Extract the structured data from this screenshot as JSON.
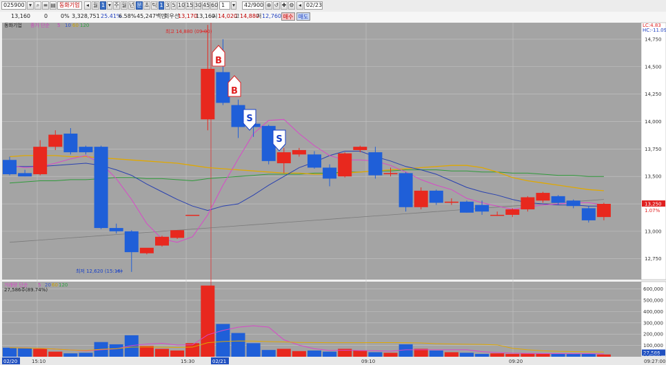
{
  "toolbar": {
    "code": "025900",
    "stock_name": "동화기업",
    "period_selected": "1",
    "tf": {
      "min_label": "분",
      "min_value": "1",
      "day": "주",
      "week": "월",
      "month": "년",
      "tick": "분",
      "sec": "초",
      "tic": "틱"
    },
    "intervals": [
      "1",
      "3",
      "5",
      "10",
      "15",
      "30",
      "45",
      "60"
    ],
    "count_value": "1",
    "count_display": "42/900",
    "date_value": "02/23"
  },
  "info": {
    "volume": "13,160",
    "change_value": "0",
    "change_pct": "0%",
    "trade_volume": "3,328,751",
    "vol_ratio1": "25.41%",
    "vol_ratio2": "6.58%",
    "amount": "45,247백만",
    "prev_close_label": "회우선",
    "prev_close": "13,170",
    "current": "13,160",
    "open_label": "시",
    "open": "14,020",
    "high_label": "고",
    "high": "14,880",
    "low_label": "저",
    "low": "12,760",
    "buy_button": "매수",
    "sell_button": "매도"
  },
  "chart_data": {
    "type": "candlestick",
    "title": "동화기업",
    "legend": {
      "label": "종가 단순",
      "periods": [
        "5",
        "10",
        "60",
        "120"
      ],
      "colors": [
        "#d040c0",
        "#3050c8",
        "#c8a000",
        "#30a040"
      ]
    },
    "side_labels": {
      "lc": "LC:4.83",
      "hc": "HC:-11.09"
    },
    "price_axis": {
      "min": 12560,
      "max": 14900,
      "ticks": [
        12750,
        13000,
        13250,
        13500,
        13750,
        14000,
        14250,
        14500,
        14750
      ]
    },
    "current_price_label": "13,250",
    "current_pct_label": "1.07%",
    "high_annotation": "최고 14,880 (09:00)",
    "low_annotation": "최저 12,620 (15:16)",
    "date_separators": [
      "02/20",
      "02/21"
    ],
    "time_labels": [
      "15:10",
      "15:30",
      "09:10",
      "09:20"
    ],
    "x_end_label": "09:27:00",
    "candles": [
      {
        "o": 13650,
        "h": 13680,
        "l": 13510,
        "c": 13520
      },
      {
        "o": 13530,
        "h": 13560,
        "l": 13500,
        "c": 13500
      },
      {
        "o": 13520,
        "h": 13830,
        "l": 13510,
        "c": 13770
      },
      {
        "o": 13770,
        "h": 13920,
        "l": 13740,
        "c": 13880
      },
      {
        "o": 13890,
        "h": 13940,
        "l": 13700,
        "c": 13720
      },
      {
        "o": 13770,
        "h": 13780,
        "l": 13700,
        "c": 13720
      },
      {
        "o": 13770,
        "h": 13780,
        "l": 13020,
        "c": 13030
      },
      {
        "o": 13030,
        "h": 13070,
        "l": 12980,
        "c": 13000
      },
      {
        "o": 13000,
        "h": 13010,
        "l": 12630,
        "c": 12810
      },
      {
        "o": 12800,
        "h": 12830,
        "l": 12790,
        "c": 12850
      },
      {
        "o": 12870,
        "h": 12960,
        "l": 12860,
        "c": 12950
      },
      {
        "o": 12940,
        "h": 13010,
        "l": 12930,
        "c": 13010
      },
      {
        "o": 13150,
        "h": 13150,
        "l": 13150,
        "c": 13150
      },
      {
        "o": 14020,
        "h": 14880,
        "l": 13920,
        "c": 14480
      },
      {
        "o": 14450,
        "h": 14750,
        "l": 14150,
        "c": 14170
      },
      {
        "o": 14150,
        "h": 14200,
        "l": 13850,
        "c": 13950
      },
      {
        "o": 13980,
        "h": 14000,
        "l": 13860,
        "c": 13950
      },
      {
        "o": 13960,
        "h": 13970,
        "l": 13610,
        "c": 13640
      },
      {
        "o": 13620,
        "h": 13760,
        "l": 13530,
        "c": 13720
      },
      {
        "o": 13700,
        "h": 13760,
        "l": 13680,
        "c": 13740
      },
      {
        "o": 13700,
        "h": 13730,
        "l": 13570,
        "c": 13580
      },
      {
        "o": 13580,
        "h": 13610,
        "l": 13410,
        "c": 13480
      },
      {
        "o": 13500,
        "h": 13720,
        "l": 13490,
        "c": 13710
      },
      {
        "o": 13740,
        "h": 13780,
        "l": 13720,
        "c": 13770
      },
      {
        "o": 13720,
        "h": 13770,
        "l": 13480,
        "c": 13510
      },
      {
        "o": 13520,
        "h": 13580,
        "l": 13500,
        "c": 13530
      },
      {
        "o": 13530,
        "h": 13540,
        "l": 13180,
        "c": 13220
      },
      {
        "o": 13220,
        "h": 13400,
        "l": 13200,
        "c": 13370
      },
      {
        "o": 13370,
        "h": 13380,
        "l": 13240,
        "c": 13260
      },
      {
        "o": 13260,
        "h": 13300,
        "l": 13240,
        "c": 13270
      },
      {
        "o": 13270,
        "h": 13280,
        "l": 13170,
        "c": 13170
      },
      {
        "o": 13240,
        "h": 13280,
        "l": 13150,
        "c": 13180
      },
      {
        "o": 13150,
        "h": 13180,
        "l": 13140,
        "c": 13150
      },
      {
        "o": 13150,
        "h": 13210,
        "l": 13130,
        "c": 13200
      },
      {
        "o": 13200,
        "h": 13320,
        "l": 13180,
        "c": 13310
      },
      {
        "o": 13280,
        "h": 13360,
        "l": 13260,
        "c": 13350
      },
      {
        "o": 13320,
        "h": 13330,
        "l": 13240,
        "c": 13260
      },
      {
        "o": 13280,
        "h": 13290,
        "l": 13210,
        "c": 13230
      },
      {
        "o": 13210,
        "h": 13230,
        "l": 13080,
        "c": 13100
      },
      {
        "o": 13130,
        "h": 13260,
        "l": 13100,
        "c": 13250
      }
    ],
    "buy_signals": [
      13,
      14
    ],
    "sell_signals": [
      15,
      17
    ],
    "ma5": [
      13600,
      13580,
      13590,
      13620,
      13660,
      13690,
      13620,
      13480,
      13290,
      13070,
      12930,
      12900,
      12950,
      13150,
      13420,
      13660,
      13890,
      14010,
      14020,
      13890,
      13780,
      13690,
      13650,
      13650,
      13640,
      13600,
      13540,
      13470,
      13420,
      13380,
      13300,
      13260,
      13230,
      13200,
      13220,
      13240,
      13250,
      13260,
      13260,
      13240
    ],
    "ma10": [
      13590,
      13590,
      13590,
      13600,
      13610,
      13620,
      13600,
      13560,
      13510,
      13430,
      13360,
      13290,
      13230,
      13190,
      13230,
      13250,
      13330,
      13420,
      13500,
      13580,
      13630,
      13690,
      13730,
      13730,
      13680,
      13640,
      13590,
      13560,
      13520,
      13460,
      13400,
      13360,
      13330,
      13290,
      13260,
      13250,
      13240,
      13240,
      13230,
      13230
    ],
    "ma60": [
      13680,
      13690,
      13690,
      13690,
      13680,
      13680,
      13670,
      13660,
      13650,
      13640,
      13630,
      13620,
      13600,
      13580,
      13570,
      13560,
      13550,
      13540,
      13530,
      13530,
      13520,
      13520,
      13530,
      13540,
      13550,
      13560,
      13570,
      13580,
      13590,
      13600,
      13600,
      13580,
      13540,
      13490,
      13460,
      13440,
      13420,
      13400,
      13380,
      13370
    ],
    "ma120": [
      13440,
      13450,
      13460,
      13460,
      13470,
      13470,
      13480,
      13490,
      13490,
      13480,
      13480,
      13470,
      13460,
      13480,
      13490,
      13500,
      13510,
      13520,
      13520,
      13520,
      13530,
      13530,
      13540,
      13540,
      13550,
      13550,
      13560,
      13560,
      13560,
      13550,
      13550,
      13540,
      13540,
      13530,
      13530,
      13520,
      13510,
      13510,
      13500,
      13500
    ],
    "ma_long": [
      12900,
      12910,
      12920,
      12930,
      12940,
      12950,
      12960,
      12970,
      12980,
      12990,
      13000,
      13010,
      13020,
      13030,
      13040,
      13050,
      13060,
      13070,
      13080,
      13090,
      13100,
      13110,
      13120,
      13130,
      13140,
      13150,
      13160,
      13170,
      13180,
      13190,
      13200,
      13210,
      13220,
      13230,
      13240,
      13250,
      13260,
      13270,
      13280,
      13290
    ],
    "volume": {
      "legend": "거래량 단순",
      "periods": [
        "5",
        "20",
        "60",
        "120"
      ],
      "current_label": "27,586주(89.74%)",
      "axis_ticks": [
        100000,
        200000,
        300000,
        400000,
        500000,
        600000
      ],
      "axis_max": 640000,
      "current_value_label": "27,586",
      "pct_label": "89.74%",
      "values": [
        80000,
        75000,
        70000,
        45000,
        30000,
        35000,
        130000,
        110000,
        190000,
        95000,
        70000,
        55000,
        120000,
        630000,
        290000,
        210000,
        120000,
        60000,
        70000,
        50000,
        55000,
        45000,
        70000,
        55000,
        40000,
        35000,
        110000,
        70000,
        55000,
        40000,
        35000,
        25000,
        30000,
        25000,
        30000,
        28000,
        25000,
        25000,
        27586,
        20000
      ]
    }
  }
}
